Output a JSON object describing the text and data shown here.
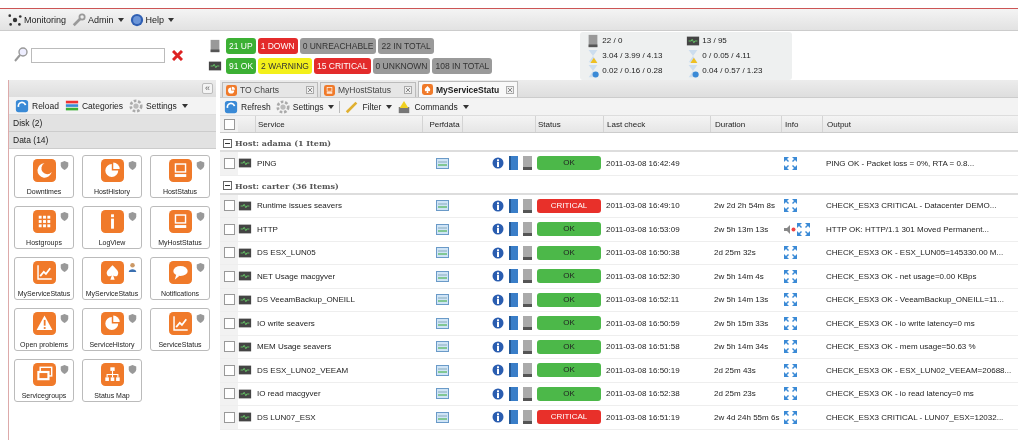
{
  "menu": [
    {
      "label": "Monitoring",
      "dropdown": false
    },
    {
      "label": "Admin",
      "dropdown": true
    },
    {
      "label": "Help",
      "dropdown": true
    }
  ],
  "host_counts": [
    {
      "label": "21 UP",
      "color": "#3cb034"
    },
    {
      "label": "1 DOWN",
      "color": "#e32b2b"
    },
    {
      "label": "0 UNREACHABLE",
      "color": "#9a9a9a"
    },
    {
      "label": "22 IN TOTAL",
      "color": "#9a9a9a"
    }
  ],
  "service_counts": [
    {
      "label": "91 OK",
      "color": "#3cb034"
    },
    {
      "label": "2 WARNING",
      "color": "#f3f01a"
    },
    {
      "label": "15 CRITICAL",
      "color": "#e32b2b"
    },
    {
      "label": "0 UNKNOWN",
      "color": "#9a9a9a"
    },
    {
      "label": "108 IN TOTAL",
      "color": "#9a9a9a"
    }
  ],
  "stats": [
    "22 / 0",
    "13 / 95",
    "3.04 / 3.99 / 4.13",
    "0 / 0.05 / 4.11",
    "0.02 / 0.16 / 0.28",
    "0.04 / 0.57 / 1.23"
  ],
  "sidebar": {
    "collapse_label": "«",
    "toolbar": [
      {
        "label": "Reload",
        "dropdown": false
      },
      {
        "label": "Categories",
        "dropdown": false
      },
      {
        "label": "Settings",
        "dropdown": true
      }
    ],
    "sections": [
      "Disk (2)",
      "Data (14)"
    ],
    "items": [
      {
        "label": "Downtimes",
        "kind": "moon",
        "personal": false
      },
      {
        "label": "HostHistory",
        "kind": "pie",
        "personal": false
      },
      {
        "label": "HostStatus",
        "kind": "monitor",
        "personal": false
      },
      {
        "label": "Hostgroups",
        "kind": "grid",
        "personal": false
      },
      {
        "label": "LogView",
        "kind": "info",
        "personal": false
      },
      {
        "label": "MyHostStatus",
        "kind": "monitor",
        "personal": false
      },
      {
        "label": "MyServiceStatus",
        "kind": "chart",
        "personal": false
      },
      {
        "label": "MyServiceStatus",
        "kind": "spade",
        "personal": true
      },
      {
        "label": "Notifications",
        "kind": "speech",
        "personal": false
      },
      {
        "label": "Open problems",
        "kind": "alert",
        "personal": false
      },
      {
        "label": "ServiceHistory",
        "kind": "pie",
        "personal": false
      },
      {
        "label": "ServiceStatus",
        "kind": "chart",
        "personal": false
      },
      {
        "label": "Servicegroups",
        "kind": "windows",
        "personal": false
      },
      {
        "label": "Status Map",
        "kind": "sitemap",
        "personal": false
      }
    ]
  },
  "tabs": [
    {
      "label": "TO Charts",
      "kind": "pie",
      "selected": false
    },
    {
      "label": "MyHostStatus",
      "kind": "monitor",
      "selected": false
    },
    {
      "label": "MyServiceStatu",
      "kind": "spade",
      "selected": true
    }
  ],
  "toolbar": [
    {
      "label": "Refresh",
      "dropdown": false
    },
    {
      "label": "Settings",
      "dropdown": true
    },
    {
      "label": "Filter",
      "dropdown": true
    },
    {
      "label": "Commands",
      "dropdown": true
    }
  ],
  "table": {
    "select_all_checked": false,
    "columns": [
      "Service",
      "Perfdata",
      "Status",
      "Last check",
      "Duration",
      "Info",
      "Output"
    ],
    "groups": [
      {
        "title": "Host: adama (1 Item)",
        "expanded": true,
        "rows": [
          {
            "checked": false,
            "service": "PING",
            "status": "OK",
            "color": "#4cb849",
            "last_check": "2011-03-08 16:42:49",
            "comment": false,
            "output": "PING OK - Packet loss = 0%, RTA = 0.8..."
          }
        ]
      },
      {
        "title": "Host: carter (36 Items)",
        "expanded": true,
        "rows": [
          {
            "checked": false,
            "service": "Runtime issues seavers",
            "status": "CRITICAL",
            "color": "#e8302a",
            "last_check": "2011-03-08 16:49:10",
            "duration": "2w 2d 2h 54m 8s",
            "comment": false,
            "output": "CHECK_ESX3 CRITICAL - Datacenter DEMO..."
          },
          {
            "checked": false,
            "service": "HTTP",
            "status": "OK",
            "color": "#4cb849",
            "last_check": "2011-03-08 16:53:09",
            "duration": "2w 5h 13m 13s",
            "comment": true,
            "output": "HTTP OK: HTTP/1.1 301 Moved Permanent..."
          },
          {
            "checked": false,
            "service": "DS ESX_LUN05",
            "status": "OK",
            "color": "#4cb849",
            "last_check": "2011-03-08 16:50:38",
            "duration": "2d 25m 32s",
            "comment": false,
            "output": "CHECK_ESX3 OK - ESX_LUN05=145330.00 M..."
          },
          {
            "checked": false,
            "service": "NET Usage macgyver",
            "status": "OK",
            "color": "#4cb849",
            "last_check": "2011-03-08 16:52:30",
            "duration": "2w 5h 14m 4s",
            "comment": false,
            "output": "CHECK_ESX3 OK - net usage=0.00 KBps"
          },
          {
            "checked": false,
            "service": "DS VeeamBackup_ONEILL",
            "status": "OK",
            "color": "#4cb849",
            "last_check": "2011-03-08 16:52:11",
            "duration": "2w 5h 14m 13s",
            "comment": false,
            "output": "CHECK_ESX3 OK - VeeamBackup_ONEILL=11..."
          },
          {
            "checked": false,
            "service": "IO write seavers",
            "status": "OK",
            "color": "#4cb849",
            "last_check": "2011-03-08 16:50:59",
            "duration": "2w 5h 15m 33s",
            "comment": false,
            "output": "CHECK_ESX3 OK - io write latency=0 ms"
          },
          {
            "checked": false,
            "service": "MEM Usage seavers",
            "status": "OK",
            "color": "#4cb849",
            "last_check": "2011-03-08 16:51:58",
            "duration": "2w 5h 14m 34s",
            "comment": false,
            "output": "CHECK_ESX3 OK - mem usage=50.63 %"
          },
          {
            "checked": false,
            "service": "DS ESX_LUN02_VEEAM",
            "status": "OK",
            "color": "#4cb849",
            "last_check": "2011-03-08 16:50:19",
            "duration": "2d 25m 43s",
            "comment": false,
            "output": "CHECK_ESX3 OK - ESX_LUN02_VEEAM=20688..."
          },
          {
            "checked": false,
            "service": "IO read macgyver",
            "status": "OK",
            "color": "#4cb849",
            "last_check": "2011-03-08 16:52:38",
            "duration": "2d 25m 23s",
            "comment": false,
            "output": "CHECK_ESX3 OK - io read latency=0 ms"
          },
          {
            "checked": false,
            "service": "DS LUN07_ESX",
            "status": "CRITICAL",
            "color": "#e8302a",
            "last_check": "2011-03-08 16:51:19",
            "duration": "2w 4d 24h 55m 6s",
            "comment": false,
            "output": "CHECK_ESX3 CRITICAL - LUN07_ESX=12032..."
          }
        ]
      }
    ]
  }
}
